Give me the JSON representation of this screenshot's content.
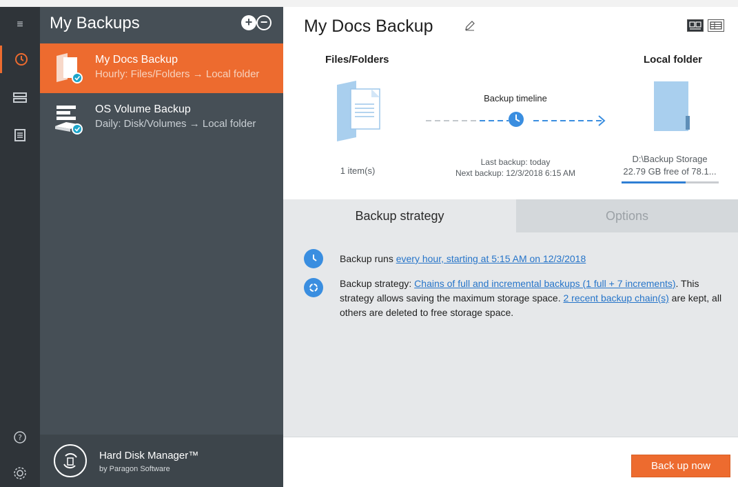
{
  "rail": {
    "items": [
      {
        "icon": "menu-icon",
        "glyph": "≡"
      },
      {
        "icon": "history-icon",
        "glyph": "⟲"
      },
      {
        "icon": "disk-icon",
        "glyph": "☷"
      },
      {
        "icon": "list-icon",
        "glyph": "☰"
      },
      {
        "icon": "help-icon",
        "glyph": "?"
      },
      {
        "icon": "settings-icon",
        "glyph": "⚙"
      }
    ]
  },
  "sidebar": {
    "title": "My Backups",
    "add_glyph": "+",
    "remove_glyph": "−",
    "items": [
      {
        "title": "My Docs Backup",
        "subtitle": "Hourly: Files/Folders → Local folder",
        "selected": true
      },
      {
        "title": "OS Volume Backup",
        "subtitle": "Daily: Disk/Volumes → Local folder",
        "selected": false
      }
    ],
    "brand": {
      "name": "Hard Disk Manager™",
      "sub": "by Paragon Software"
    }
  },
  "main": {
    "title": "My Docs Backup",
    "source": {
      "heading": "Files/Folders",
      "count": "1 item(s)"
    },
    "timeline": {
      "label": "Backup timeline",
      "last": "Last backup: today",
      "next": "Next backup: 12/3/2018 6:15 AM"
    },
    "destination": {
      "heading": "Local folder",
      "path": "D:\\Backup Storage",
      "free": "22.79 GB free of 78.1...",
      "used_fraction": 0.66
    },
    "tabs": [
      {
        "label": "Backup strategy",
        "active": true
      },
      {
        "label": "Options",
        "active": false
      }
    ],
    "schedule": {
      "prefix": "Backup runs ",
      "link": "every hour, starting at 5:15 AM on 12/3/2018"
    },
    "strategy": {
      "prefix": "Backup strategy: ",
      "link1": "Chains of full and incremental backups (1 full + 7 increments)",
      "mid": ". This strategy allows saving the maximum storage space. ",
      "link2": "2 recent backup chain(s)",
      "suffix": " are kept, all others are deleted to free storage space."
    },
    "action_label": "Back up now"
  },
  "colors": {
    "accent": "#ed6b2f",
    "link": "#2574c9",
    "sidebar": "#464f56",
    "rail": "#2f3439"
  }
}
